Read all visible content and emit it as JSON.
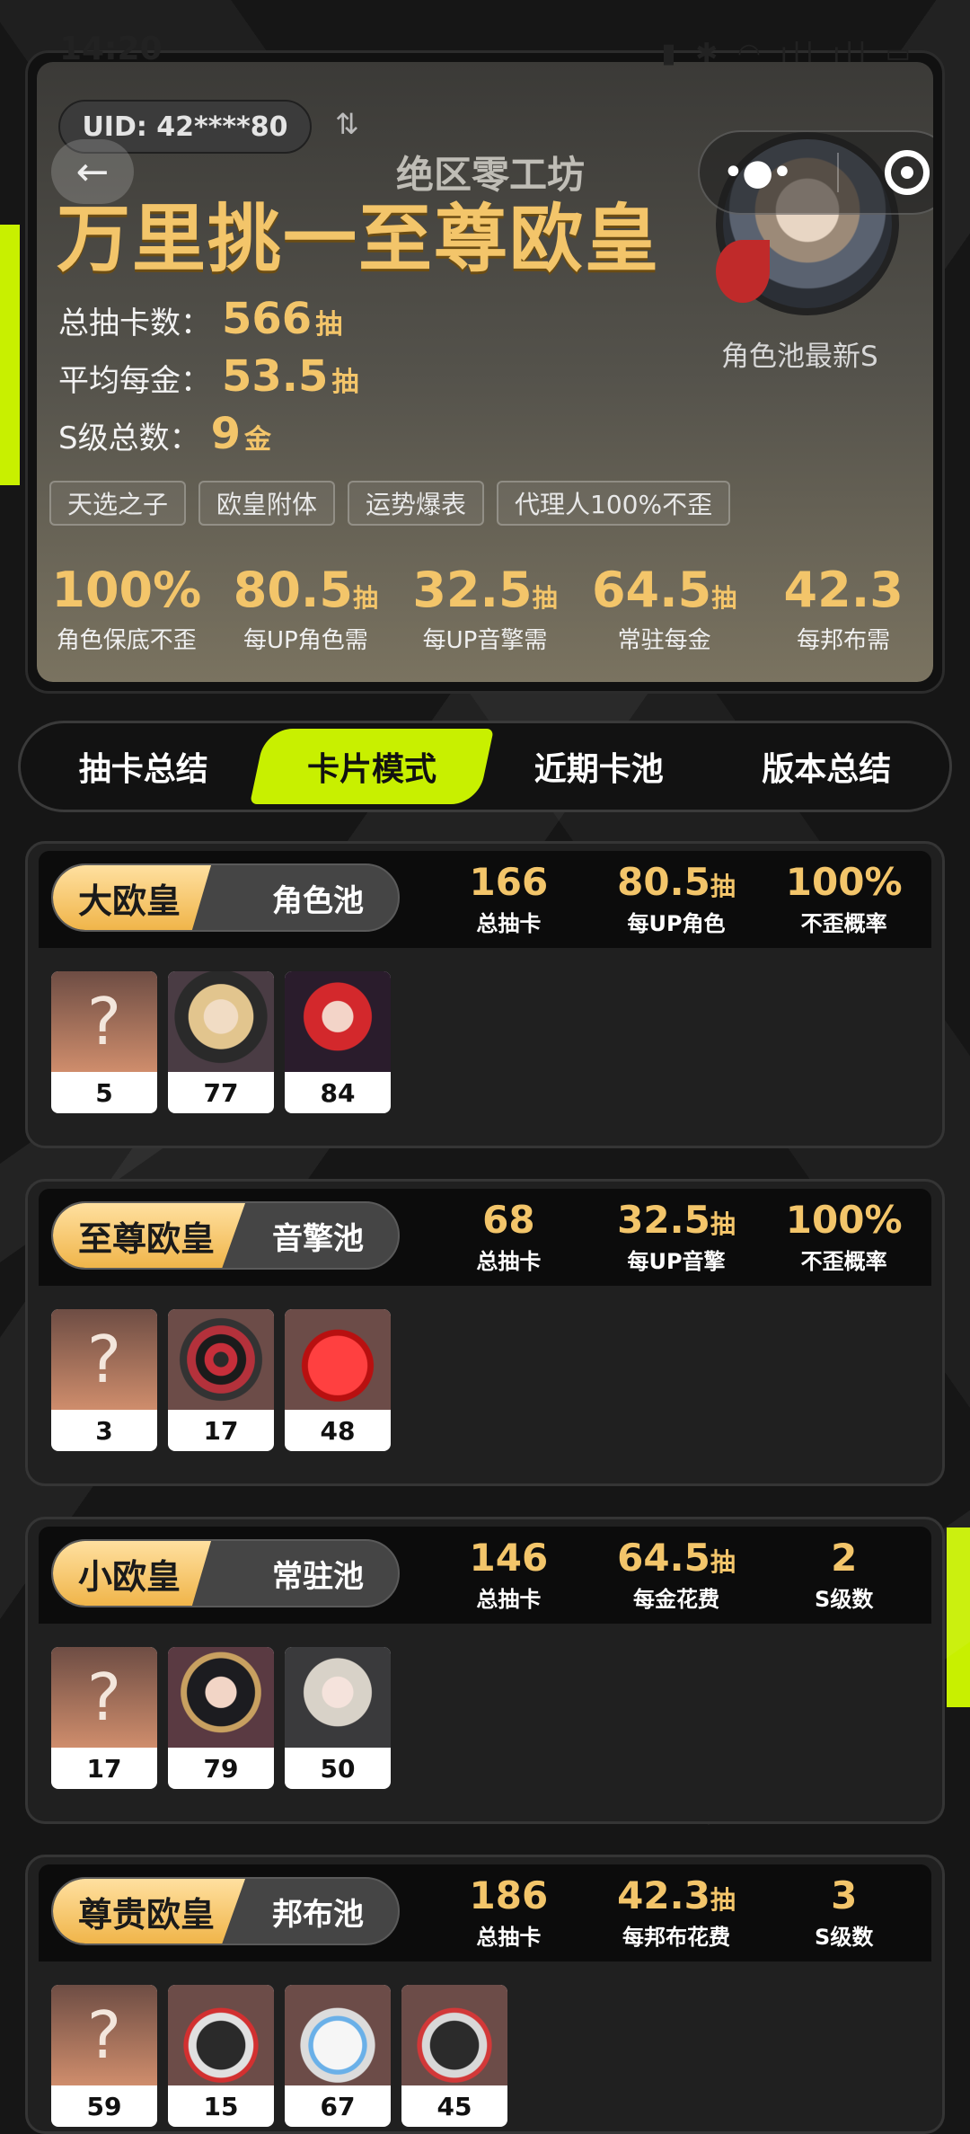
{
  "status_bar": {
    "time": "14:20",
    "icons": "▮ ✱ ◠ ıll ıll ▭"
  },
  "header": {
    "uid": "UID: 42****80",
    "swap_icon": "⇅",
    "back_icon": "←",
    "game_name": "绝区零工坊",
    "title": "万里挑一至尊欧皇",
    "avatar_label": "角色池最新S",
    "stats": [
      {
        "label": "总抽卡数：",
        "value": "566",
        "unit": "抽"
      },
      {
        "label": "平均每金：",
        "value": "53.5",
        "unit": "抽"
      },
      {
        "label": "S级总数：",
        "value": "9",
        "unit": "金"
      }
    ],
    "tags": [
      "天选之子",
      "欧皇附体",
      "运势爆表",
      "代理人100%不歪"
    ],
    "metrics": [
      {
        "value": "100%",
        "unit": "",
        "label": "角色保底不歪"
      },
      {
        "value": "80.5",
        "unit": "抽",
        "label": "每UP角色需"
      },
      {
        "value": "32.5",
        "unit": "抽",
        "label": "每UP音擎需"
      },
      {
        "value": "64.5",
        "unit": "抽",
        "label": "常驻每金"
      },
      {
        "value": "42.3",
        "unit": "",
        "label": "每邦布需"
      }
    ]
  },
  "tabs": [
    "抽卡总结",
    "卡片模式",
    "近期卡池",
    "版本总结"
  ],
  "pools": [
    {
      "rank": "大欧皇",
      "type": "角色池",
      "stats": [
        {
          "value": "166",
          "unit": "",
          "label": "总抽卡"
        },
        {
          "value": "80.5",
          "unit": "抽",
          "label": "每UP角色"
        },
        {
          "value": "100%",
          "unit": "",
          "label": "不歪概率"
        }
      ],
      "items": [
        {
          "label": "?",
          "count": "5"
        },
        {
          "count": "77"
        },
        {
          "count": "84"
        }
      ]
    },
    {
      "rank": "至尊欧皇",
      "type": "音擎池",
      "stats": [
        {
          "value": "68",
          "unit": "",
          "label": "总抽卡"
        },
        {
          "value": "32.5",
          "unit": "抽",
          "label": "每UP音擎"
        },
        {
          "value": "100%",
          "unit": "",
          "label": "不歪概率"
        }
      ],
      "items": [
        {
          "label": "?",
          "count": "3"
        },
        {
          "count": "17"
        },
        {
          "count": "48"
        }
      ]
    },
    {
      "rank": "小欧皇",
      "type": "常驻池",
      "stats": [
        {
          "value": "146",
          "unit": "",
          "label": "总抽卡"
        },
        {
          "value": "64.5",
          "unit": "抽",
          "label": "每金花费"
        },
        {
          "value": "2",
          "unit": "",
          "label": "S级数"
        }
      ],
      "items": [
        {
          "label": "?",
          "count": "17"
        },
        {
          "count": "79"
        },
        {
          "count": "50"
        }
      ]
    },
    {
      "rank": "尊贵欧皇",
      "type": "邦布池",
      "stats": [
        {
          "value": "186",
          "unit": "",
          "label": "总抽卡"
        },
        {
          "value": "42.3",
          "unit": "抽",
          "label": "每邦布花费"
        },
        {
          "value": "3",
          "unit": "",
          "label": "S级数"
        }
      ],
      "items": [
        {
          "label": "?",
          "count": "59"
        },
        {
          "count": "15"
        },
        {
          "count": "67"
        },
        {
          "count": "45"
        }
      ]
    }
  ],
  "colors": {
    "accent": "#c8f000",
    "gold": "#f3c56a",
    "background": "#161616"
  }
}
